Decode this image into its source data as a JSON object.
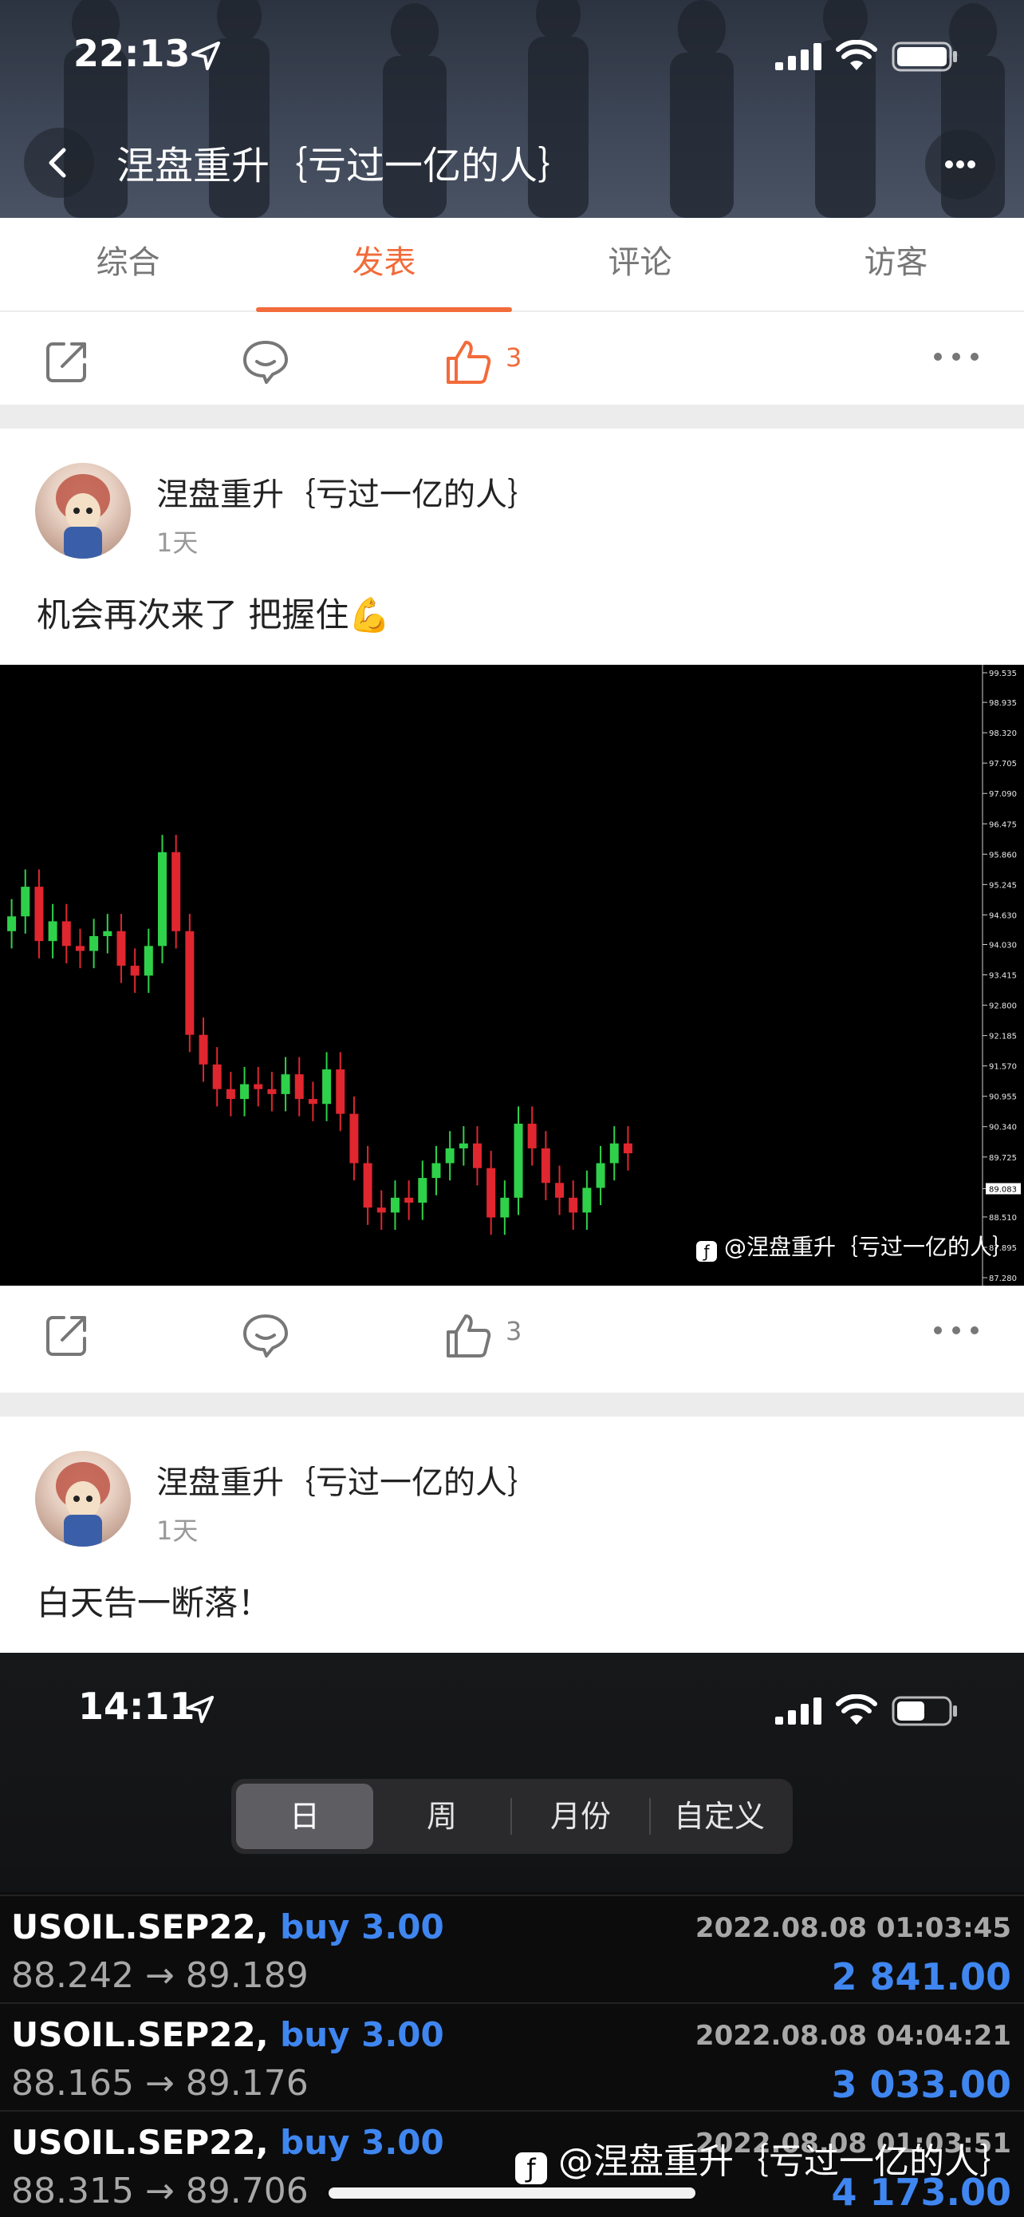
{
  "status_bar": {
    "time": "22:13"
  },
  "header": {
    "title": "涅盘重升｛亏过一亿的人｝"
  },
  "tabs": [
    {
      "label": "综合",
      "active": false
    },
    {
      "label": "发表",
      "active": true
    },
    {
      "label": "评论",
      "active": false
    },
    {
      "label": "访客",
      "active": false
    }
  ],
  "action_bar_top": {
    "like_count": "3",
    "like_active": true
  },
  "post1": {
    "author": "涅盘重升｛亏过一亿的人｝",
    "time": "1天",
    "text": "机会再次来了 把握住💪",
    "chart_watermark": "@涅盘重升｛亏过一亿的人｝",
    "like_count": "3"
  },
  "post2": {
    "author": "涅盘重升｛亏过一亿的人｝",
    "time": "1天",
    "text": "白天告一断落！"
  },
  "embedded_screenshot": {
    "time": "14:11",
    "segments": [
      "日",
      "周",
      "月份",
      "自定义"
    ],
    "trades": [
      {
        "symbol": "USOIL.SEP22,",
        "side": "buy 3.00",
        "datetime": "2022.08.08 01:03:45",
        "prices": "88.242 → 89.189",
        "profit": "2 841.00"
      },
      {
        "symbol": "USOIL.SEP22,",
        "side": "buy 3.00",
        "datetime": "2022.08.08 04:04:21",
        "prices": "88.165 → 89.176",
        "profit": "3 033.00"
      },
      {
        "symbol": "USOIL.SEP22,",
        "side": "buy 3.00",
        "datetime": "2022.08.08 01:03:51",
        "prices": "88.315 → 89.706",
        "profit": "4 173.00"
      }
    ],
    "watermark": "@涅盘重升｛亏过一亿的人｝"
  },
  "chart_data": {
    "type": "candlestick",
    "y_ticks": [
      "99.535",
      "98.935",
      "98.320",
      "97.705",
      "97.090",
      "96.475",
      "95.860",
      "95.245",
      "94.630",
      "94.030",
      "93.415",
      "92.800",
      "92.185",
      "91.570",
      "90.955",
      "90.340",
      "89.725",
      "89.083",
      "88.510",
      "87.895",
      "87.280"
    ],
    "current_price": "89.083",
    "ylim": [
      87.28,
      99.535
    ],
    "colors": {
      "up": "#2fd14a",
      "down": "#e0262f",
      "background": "#000000"
    },
    "closes": [
      94.6,
      95.2,
      94.1,
      94.5,
      94.0,
      93.9,
      94.2,
      94.3,
      93.6,
      93.4,
      94.0,
      95.9,
      94.3,
      92.2,
      91.6,
      91.1,
      90.9,
      91.2,
      91.1,
      91.0,
      91.4,
      90.9,
      90.8,
      91.5,
      90.6,
      89.6,
      88.7,
      88.6,
      88.9,
      88.8,
      89.3,
      89.6,
      89.9,
      90.0,
      89.5,
      88.5,
      88.9,
      90.4,
      89.9,
      89.2,
      88.9,
      88.6,
      89.1,
      89.6,
      90.0,
      89.8
    ]
  }
}
